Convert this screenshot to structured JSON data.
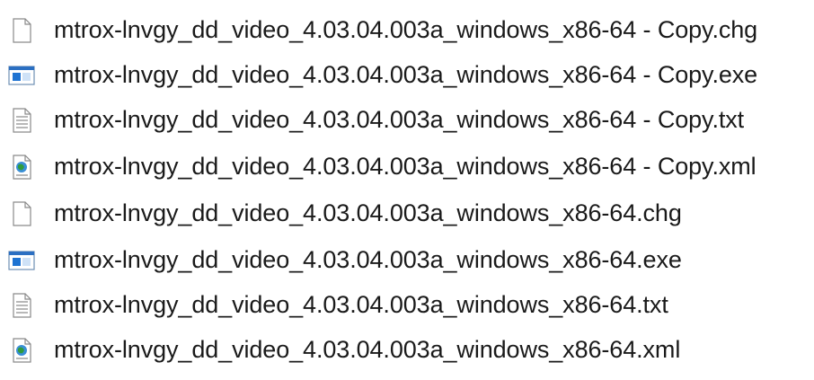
{
  "files": [
    {
      "name": "mtrox-lnvgy_dd_video_4.03.04.003a_windows_x86-64 - Copy.chg",
      "icon": "generic-file-icon"
    },
    {
      "name": "mtrox-lnvgy_dd_video_4.03.04.003a_windows_x86-64 - Copy.exe",
      "icon": "application-exe-icon"
    },
    {
      "name": "mtrox-lnvgy_dd_video_4.03.04.003a_windows_x86-64 - Copy.txt",
      "icon": "text-file-icon"
    },
    {
      "name": "mtrox-lnvgy_dd_video_4.03.04.003a_windows_x86-64 - Copy.xml",
      "icon": "xml-file-icon"
    },
    {
      "name": "mtrox-lnvgy_dd_video_4.03.04.003a_windows_x86-64.chg",
      "icon": "generic-file-icon"
    },
    {
      "name": "mtrox-lnvgy_dd_video_4.03.04.003a_windows_x86-64.exe",
      "icon": "application-exe-icon"
    },
    {
      "name": "mtrox-lnvgy_dd_video_4.03.04.003a_windows_x86-64.txt",
      "icon": "text-file-icon"
    },
    {
      "name": "mtrox-lnvgy_dd_video_4.03.04.003a_windows_x86-64.xml",
      "icon": "xml-file-icon"
    }
  ],
  "colors": {
    "text": "#1a1a1a",
    "exe_accent": "#1e73d2",
    "xml_globe": "#2f9c3c"
  }
}
